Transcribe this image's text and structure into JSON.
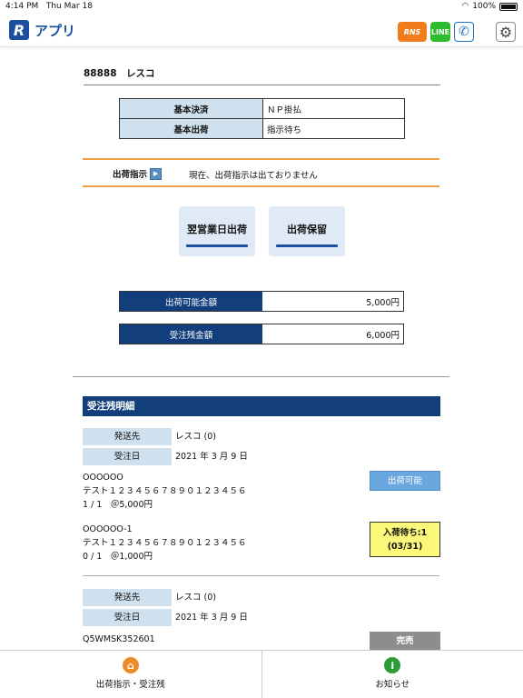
{
  "status": {
    "time": "4:14 PM",
    "date": "Thu Mar 18",
    "battery": "100%"
  },
  "header": {
    "logo_letter": "R",
    "app_name": "アプリ",
    "rns_label": "RNS",
    "line_label": "LINE",
    "phone_icon": "phone-icon",
    "gear_icon": "gear-icon"
  },
  "customer": {
    "name": "88888　レスコ"
  },
  "basic": [
    {
      "key": "基本決済",
      "value": "ＮＰ掛払"
    },
    {
      "key": "基本出荷",
      "value": "指示待ち"
    }
  ],
  "shipping": {
    "label": "出荷指示",
    "status": "現在、出荷指示は出ておりません"
  },
  "actions": {
    "next_day": "翌営業日出荷",
    "hold": "出荷保留"
  },
  "amounts": [
    {
      "key": "出荷可能金額",
      "value": "5,000円"
    },
    {
      "key": "受注残金額",
      "value": "6,000円"
    }
  ],
  "detail": {
    "title": "受注残明細",
    "labels": {
      "dest": "発送先",
      "date": "受注日"
    },
    "orders": [
      {
        "dest": "レスコ (0)",
        "date": "2021 年 3 月 9 日",
        "items": [
          {
            "code": "OOOOOO",
            "name": "テスト１２３４５６７８９０１２３４５６",
            "qty": "1 / 1　＠5,000円",
            "status": "出荷可能",
            "status_sub": ""
          },
          {
            "code": "OOOOOO-1",
            "name": "テスト１２３４５６７８９０１２３４５６",
            "qty": "0 / 1　＠1,000円",
            "status": "入荷待ち:1",
            "status_sub": "(03/31)"
          }
        ]
      },
      {
        "dest": "レスコ (0)",
        "date": "2021 年 3 月 9 日",
        "items": [
          {
            "code": "Q5WMSK352601",
            "status": "完売"
          }
        ]
      }
    ]
  },
  "tabs": [
    {
      "label": "出荷指示・受注残",
      "icon": "home-icon"
    },
    {
      "label": "お知らせ",
      "icon": "info-icon"
    }
  ]
}
